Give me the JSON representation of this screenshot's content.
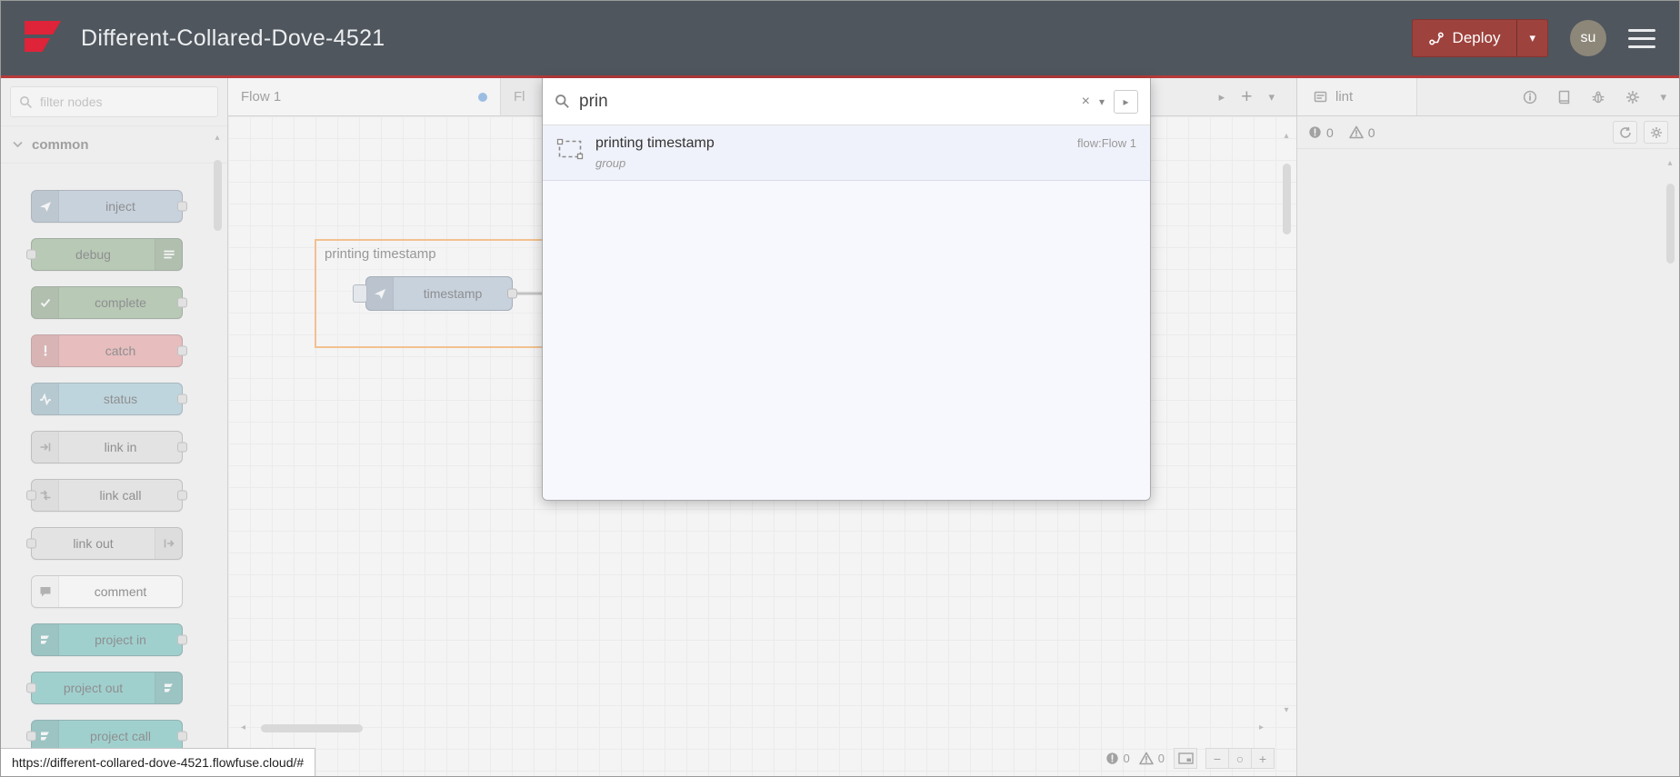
{
  "colors": {
    "header_bg": "#4f565e",
    "accent_red": "#b73a3a",
    "brand_red": "#df2339",
    "deploy_red": "#9e423d",
    "selection_orange": "#fb9832",
    "unsaved_dot_blue": "#4f90d8"
  },
  "header": {
    "title": "Different-Collared-Dove-4521",
    "deploy": {
      "label": "Deploy"
    },
    "user": {
      "initials": "su"
    }
  },
  "palette": {
    "filter_placeholder": "filter nodes",
    "category": "common",
    "nodes": [
      {
        "label": "inject",
        "color": "#a6bbcf"
      },
      {
        "label": "debug",
        "color": "#87a980"
      },
      {
        "label": "complete",
        "color": "#87a980"
      },
      {
        "label": "catch",
        "color": "#e49191"
      },
      {
        "label": "status",
        "color": "#94c1d0"
      },
      {
        "label": "link in",
        "color": "#dddddd"
      },
      {
        "label": "link call",
        "color": "#dddddd"
      },
      {
        "label": "link out",
        "color": "#dddddd"
      },
      {
        "label": "comment",
        "color": "#ffffff"
      },
      {
        "label": "project in",
        "color": "#57b6b0"
      },
      {
        "label": "project out",
        "color": "#57b6b0"
      },
      {
        "label": "project call",
        "color": "#57b6b0"
      }
    ]
  },
  "workspace": {
    "tab1": "Flow 1",
    "tab2_fragment": "Fl",
    "group_label": "printing timestamp",
    "node_label": "timestamp",
    "footer": {
      "errors": "0",
      "warnings": "0"
    }
  },
  "search": {
    "query": "prin",
    "results": [
      {
        "title": "printing timestamp",
        "type": "group",
        "flow": "flow:Flow 1"
      }
    ]
  },
  "sidebar": {
    "tab": "lint",
    "errors": "0",
    "warnings": "0"
  },
  "statusbar": {
    "url": "https://different-collared-dove-4521.flowfuse.cloud/#"
  },
  "icons": {
    "caret_down": "▾",
    "caret_right": "▸",
    "scroll_up": "▴",
    "scroll_down": "▾",
    "scroll_left": "◂",
    "scroll_right": "▸",
    "plus": "+",
    "minus": "−",
    "zoom_reset": "○",
    "clear_x": "×"
  }
}
